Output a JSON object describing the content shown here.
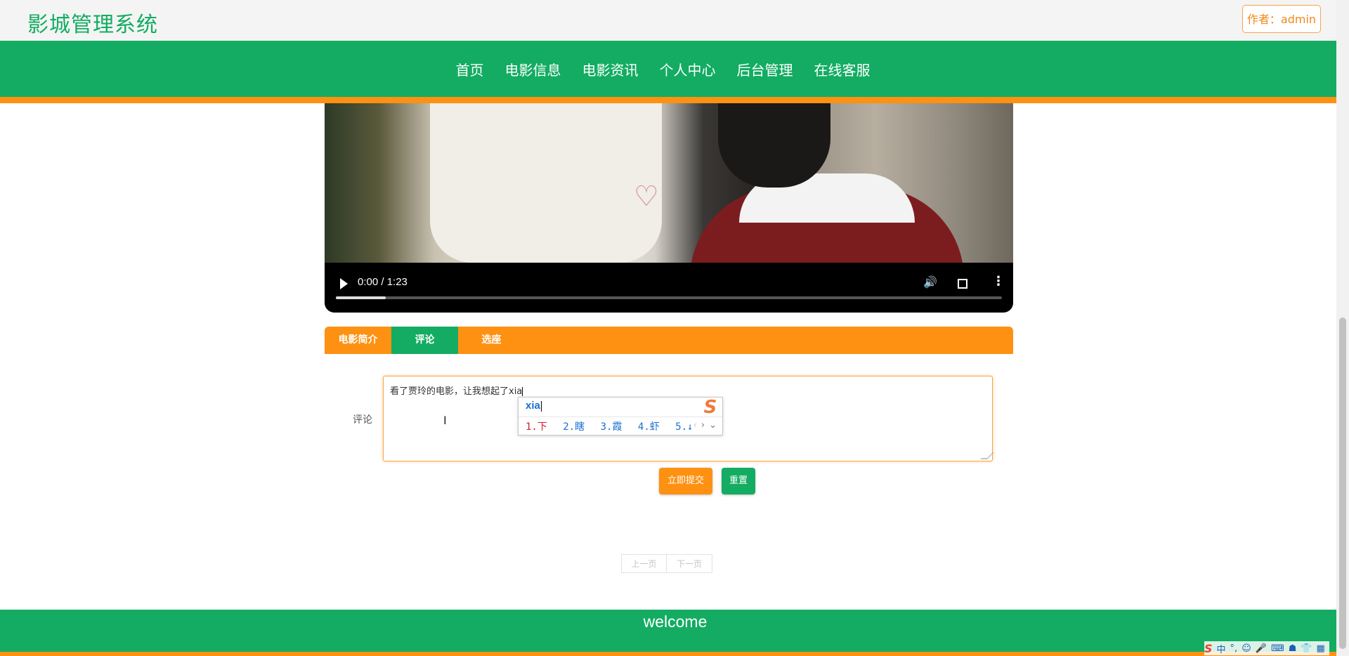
{
  "header": {
    "site_title": "影城管理系统",
    "author_label": "作者：admin"
  },
  "nav": {
    "items": [
      "首页",
      "电影信息",
      "电影资讯",
      "个人中心",
      "后台管理",
      "在线客服"
    ]
  },
  "video": {
    "time_display": "0:00 / 1:23",
    "buffered_fraction": 0.075,
    "icons": [
      "play-icon",
      "volume-icon",
      "fullscreen-icon",
      "more-options-icon"
    ]
  },
  "tabs": {
    "items": [
      "电影简介",
      "评论",
      "选座"
    ],
    "active": "评论"
  },
  "comment_form": {
    "label": "评论",
    "value": "看了贾玲的电影，让我想起了xia"
  },
  "ime": {
    "composition": "xia",
    "candidates": [
      "1.下",
      "2.瞎",
      "3.霞",
      "4.虾",
      "5.↓"
    ],
    "logo": "S"
  },
  "buttons": {
    "submit": "立即提交",
    "reset": "重置"
  },
  "pagination": {
    "prev": "上一页",
    "next": "下一页"
  },
  "footer": {
    "text": "welcome"
  },
  "tray": {
    "logo": "S",
    "mode": "中",
    "punct": "°,"
  },
  "colors": {
    "brand_green": "#13ac62",
    "accent_orange": "#fe9112"
  }
}
